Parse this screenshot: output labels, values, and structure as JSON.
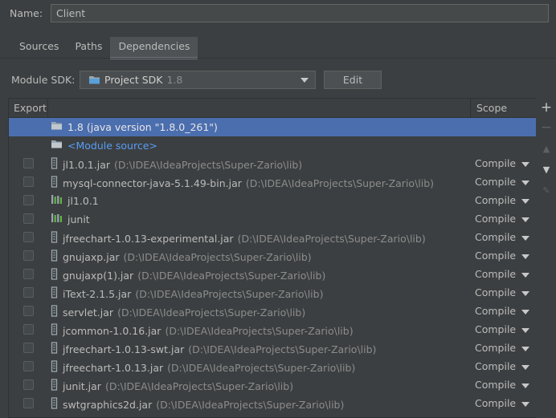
{
  "name_field": {
    "label": "Name:",
    "value": "Client"
  },
  "tabs": [
    {
      "label": "Sources",
      "active": false
    },
    {
      "label": "Paths",
      "active": false
    },
    {
      "label": "Dependencies",
      "active": true
    }
  ],
  "module_sdk": {
    "label": "Module SDK:",
    "value": "Project SDK",
    "version": "1.8",
    "edit_label": "Edit"
  },
  "table": {
    "headers": {
      "export": "Export",
      "scope": "Scope"
    },
    "rows": [
      {
        "kind": "sdk",
        "name": "1.8 (java version \"1.8.0_261\")",
        "path": "",
        "scope": "",
        "checkbox": false,
        "selected": true,
        "icon": "folder-icon"
      },
      {
        "kind": "module-source",
        "name": "<Module source>",
        "path": "",
        "scope": "",
        "checkbox": false,
        "selected": false,
        "icon": "folder-icon"
      },
      {
        "kind": "jar",
        "name": "jl1.0.1.jar",
        "path": "(D:\\IDEA\\IdeaProjects\\Super-Zario\\lib)",
        "scope": "Compile",
        "checkbox": true,
        "icon": "jar-icon"
      },
      {
        "kind": "jar",
        "name": "mysql-connector-java-5.1.49-bin.jar",
        "path": "(D:\\IDEA\\IdeaProjects\\Super-Zario\\lib)",
        "scope": "Compile",
        "checkbox": true,
        "icon": "jar-icon"
      },
      {
        "kind": "library",
        "name": "jl1.0.1",
        "path": "",
        "scope": "Compile",
        "checkbox": true,
        "icon": "library-icon"
      },
      {
        "kind": "library",
        "name": "junit",
        "path": "",
        "scope": "Compile",
        "checkbox": true,
        "icon": "library-icon"
      },
      {
        "kind": "jar",
        "name": "jfreechart-1.0.13-experimental.jar",
        "path": "(D:\\IDEA\\IdeaProjects\\Super-Zario\\lib)",
        "scope": "Compile",
        "checkbox": true,
        "icon": "jar-icon"
      },
      {
        "kind": "jar",
        "name": "gnujaxp.jar",
        "path": "(D:\\IDEA\\IdeaProjects\\Super-Zario\\lib)",
        "scope": "Compile",
        "checkbox": true,
        "icon": "jar-icon"
      },
      {
        "kind": "jar",
        "name": "gnujaxp(1).jar",
        "path": "(D:\\IDEA\\IdeaProjects\\Super-Zario\\lib)",
        "scope": "Compile",
        "checkbox": true,
        "icon": "jar-icon"
      },
      {
        "kind": "jar",
        "name": "iText-2.1.5.jar",
        "path": "(D:\\IDEA\\IdeaProjects\\Super-Zario\\lib)",
        "scope": "Compile",
        "checkbox": true,
        "icon": "jar-icon"
      },
      {
        "kind": "jar",
        "name": "servlet.jar",
        "path": "(D:\\IDEA\\IdeaProjects\\Super-Zario\\lib)",
        "scope": "Compile",
        "checkbox": true,
        "icon": "jar-icon"
      },
      {
        "kind": "jar",
        "name": "jcommon-1.0.16.jar",
        "path": "(D:\\IDEA\\IdeaProjects\\Super-Zario\\lib)",
        "scope": "Compile",
        "checkbox": true,
        "icon": "jar-icon"
      },
      {
        "kind": "jar",
        "name": "jfreechart-1.0.13-swt.jar",
        "path": "(D:\\IDEA\\IdeaProjects\\Super-Zario\\lib)",
        "scope": "Compile",
        "checkbox": true,
        "icon": "jar-icon"
      },
      {
        "kind": "jar",
        "name": "jfreechart-1.0.13.jar",
        "path": "(D:\\IDEA\\IdeaProjects\\Super-Zario\\lib)",
        "scope": "Compile",
        "checkbox": true,
        "icon": "jar-icon"
      },
      {
        "kind": "jar",
        "name": "junit.jar",
        "path": "(D:\\IDEA\\IdeaProjects\\Super-Zario\\lib)",
        "scope": "Compile",
        "checkbox": true,
        "icon": "jar-icon"
      },
      {
        "kind": "jar",
        "name": "swtgraphics2d.jar",
        "path": "(D:\\IDEA\\IdeaProjects\\Super-Zario\\lib)",
        "scope": "Compile",
        "checkbox": true,
        "icon": "jar-icon"
      }
    ]
  },
  "toolbar": [
    {
      "name": "add-icon",
      "glyph": "+",
      "enabled": true
    },
    {
      "name": "remove-icon",
      "glyph": "−",
      "enabled": false
    },
    {
      "name": "move-up-icon",
      "glyph": "▲",
      "enabled": false
    },
    {
      "name": "move-down-icon",
      "glyph": "▼",
      "enabled": true
    },
    {
      "name": "edit-icon",
      "glyph": "✎",
      "enabled": false
    }
  ],
  "colors": {
    "background": "#3c3f41",
    "selection": "#4b6eaf",
    "module_source": "#589df6",
    "path_text": "#8c8c8c"
  }
}
